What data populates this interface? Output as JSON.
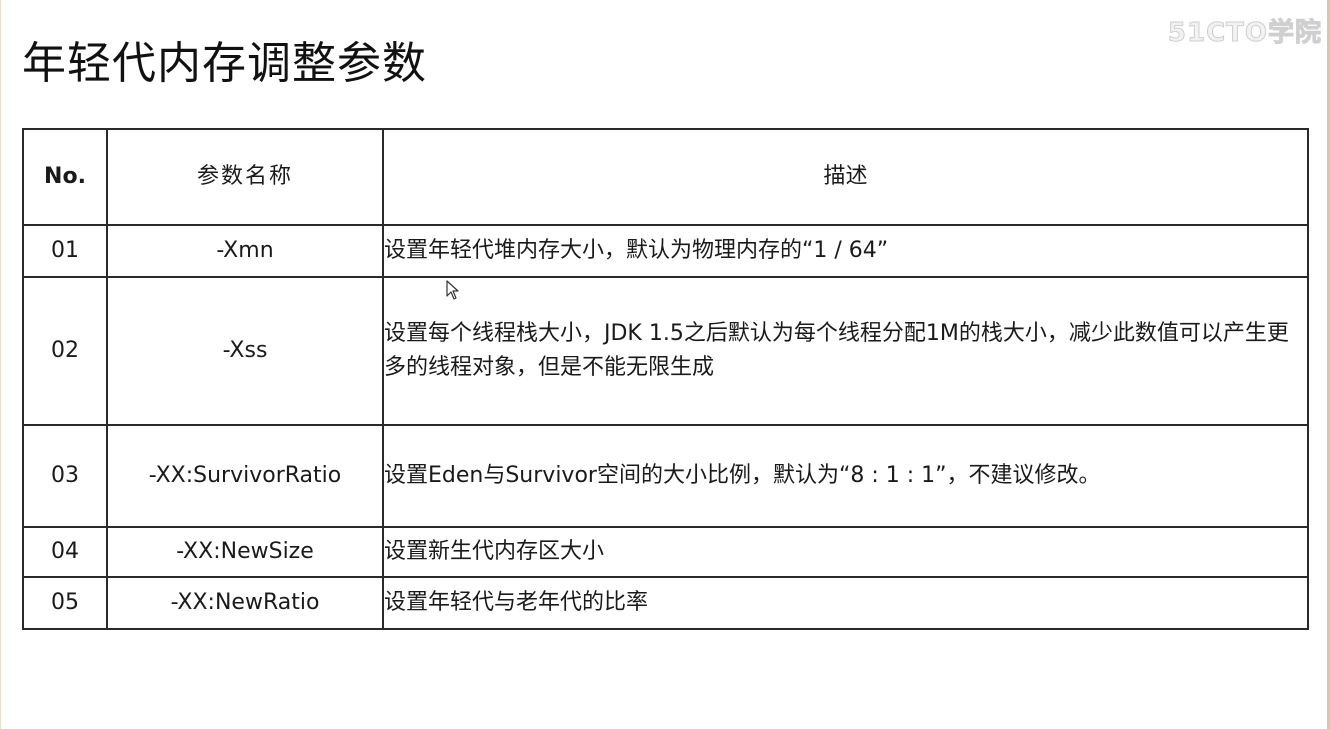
{
  "title": "年轻代内存调整参数",
  "watermark": "51CTO学院",
  "table": {
    "headers": {
      "no": "No.",
      "name": "参数名称",
      "desc": "描述"
    },
    "rows": [
      {
        "no": "01",
        "name": "-Xmn",
        "desc": "设置年轻代堆内存大小，默认为物理内存的“1 / 64”"
      },
      {
        "no": "02",
        "name": "-Xss",
        "desc": "设置每个线程栈大小，JDK 1.5之后默认为每个线程分配1M的栈大小，减少此数值可以产生更多的线程对象，但是不能无限生成"
      },
      {
        "no": "03",
        "name": "-XX:SurvivorRatio",
        "desc": "设置Eden与Survivor空间的大小比例，默认为“8 : 1 : 1”，不建议修改。"
      },
      {
        "no": "04",
        "name": "-XX:NewSize",
        "desc": "设置新生代内存区大小"
      },
      {
        "no": "05",
        "name": "-XX:NewRatio",
        "desc": "设置年轻代与老年代的比率"
      }
    ]
  }
}
